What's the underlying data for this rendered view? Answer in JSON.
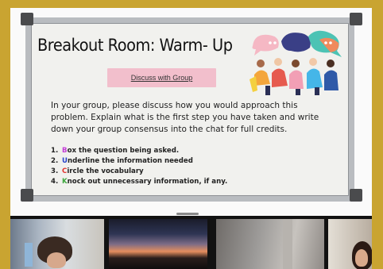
{
  "slide": {
    "title": "Breakout Room: Warm- Up",
    "button_label": "Discuss with Group",
    "paragraph": "In your group, please discuss how you would approach this problem. Explain what is the first step you have taken and write down your group consensus into the chat for full credits.",
    "steps": [
      {
        "num": "1.",
        "letter": "B",
        "rest": "ox the question being asked.",
        "color": "#c23bd6"
      },
      {
        "num": "2.",
        "letter": "U",
        "rest": "nderline the information needed",
        "color": "#2a45c8"
      },
      {
        "num": "3.",
        "letter": "C",
        "rest": "ircle the vocabulary",
        "color": "#e0322c"
      },
      {
        "num": "4.",
        "letter": "K",
        "rest": "nock out unnecessary information, if any.",
        "color": "#3ea63e"
      }
    ]
  },
  "participants": [
    {
      "name": "participant-1"
    },
    {
      "name": "participant-2"
    },
    {
      "name": "participant-3"
    },
    {
      "name": "participant-4"
    }
  ]
}
